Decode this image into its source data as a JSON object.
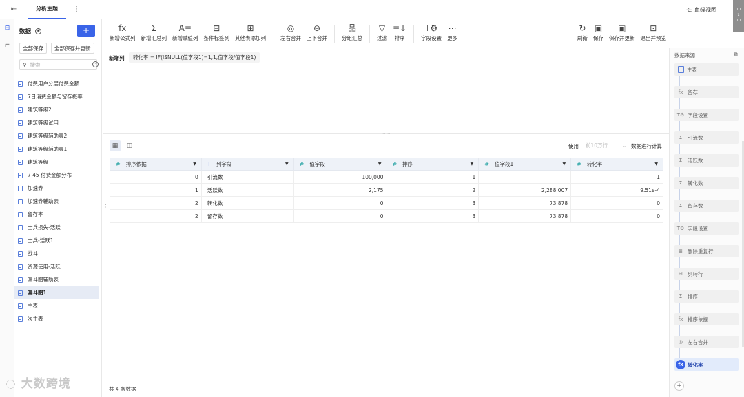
{
  "topbar": {
    "tab_label": "分析主题",
    "right_label": "血缘视图",
    "badge_lines": [
      "0.1",
      "1",
      "0.1"
    ]
  },
  "sidebar": {
    "title": "数据",
    "save_all": "全部保存",
    "save_all_update": "全部保存并更新",
    "search_placeholder": "搜索",
    "items": [
      {
        "label": "付费用户分层付费金额"
      },
      {
        "label": "7日消费金额与留存概率"
      },
      {
        "label": "建筑等级2"
      },
      {
        "label": "建筑等级试用"
      },
      {
        "label": "建筑等级辅助表2"
      },
      {
        "label": "建筑等级辅助表1"
      },
      {
        "label": "建筑等级"
      },
      {
        "label": "7 45 付费金额分布"
      },
      {
        "label": "加速券"
      },
      {
        "label": "加速券辅助表"
      },
      {
        "label": "留存率"
      },
      {
        "label": "士兵损失-活跃"
      },
      {
        "label": "士兵-活跃1"
      },
      {
        "label": "战斗"
      },
      {
        "label": "资源使用-活跃"
      },
      {
        "label": "漏斗图辅助表"
      },
      {
        "label": "漏斗图1",
        "selected": true
      },
      {
        "label": "主表"
      },
      {
        "label": "次主表"
      }
    ]
  },
  "toolbar": {
    "left": [
      {
        "icon": "fx",
        "label": "新增公式列",
        "name": "add-formula-column-button"
      },
      {
        "icon": "Σ",
        "label": "新增汇总列",
        "name": "add-summary-column-button"
      },
      {
        "icon": "A≡",
        "label": "新增赋值列",
        "name": "add-assign-column-button"
      },
      {
        "icon": "⊟",
        "label": "条件标签列",
        "name": "condition-label-column-button"
      },
      {
        "icon": "⊞",
        "label": "其他表添加列",
        "name": "add-column-from-table-button"
      },
      {
        "icon": "◎",
        "label": "左右合并",
        "name": "left-right-merge-button"
      },
      {
        "icon": "⊖",
        "label": "上下合并",
        "name": "up-down-merge-button"
      },
      {
        "icon": "品",
        "label": "分组汇总",
        "name": "group-summary-button"
      },
      {
        "icon": "▽",
        "label": "过滤",
        "name": "filter-button"
      },
      {
        "icon": "≡↓",
        "label": "排序",
        "name": "sort-button"
      },
      {
        "icon": "T⚙",
        "label": "字段设置",
        "name": "field-settings-button"
      },
      {
        "icon": "⋯",
        "label": "更多",
        "name": "more-button"
      }
    ],
    "right": [
      {
        "icon": "↻",
        "label": "刷新",
        "name": "refresh-button"
      },
      {
        "icon": "▣",
        "label": "保存",
        "name": "save-button"
      },
      {
        "icon": "▣",
        "label": "保存并更新",
        "name": "save-update-button"
      },
      {
        "icon": "⊡",
        "label": "退出并预览",
        "name": "exit-preview-button"
      }
    ]
  },
  "formula": {
    "label": "新增列",
    "expression": "转化率 = IF(ISNULL(值字段1)=1,1,值字段/值字段1)"
  },
  "gridbar": {
    "use_label": "使用",
    "rows_placeholder": "前10万行",
    "calc_label": "数据进行计算"
  },
  "table": {
    "columns": [
      {
        "type": "#",
        "label": "排序依据"
      },
      {
        "type": "T",
        "label": "列字段"
      },
      {
        "type": "#",
        "label": "值字段"
      },
      {
        "type": "#",
        "label": "排序"
      },
      {
        "type": "#",
        "label": "值字段1"
      },
      {
        "type": "#",
        "label": "转化率"
      }
    ],
    "rows": [
      [
        "0",
        "引流数",
        "100,000",
        "1",
        "",
        "1"
      ],
      [
        "1",
        "活跃数",
        "2,175",
        "2",
        "2,288,007",
        "9.51e-4"
      ],
      [
        "2",
        "转化数",
        "0",
        "3",
        "73,878",
        "0"
      ],
      [
        "2",
        "留存数",
        "0",
        "3",
        "73,878",
        "0"
      ]
    ]
  },
  "footer": {
    "count_text": "共 4 条数据"
  },
  "watermark": {
    "text": "大数跨境"
  },
  "right_panel": {
    "title": "数据来源",
    "nodes": [
      {
        "icon": "doc",
        "label": "主表"
      },
      {
        "icon": "fx",
        "label": "留存"
      },
      {
        "icon": "T⚙",
        "label": "字段设置"
      },
      {
        "icon": "Σ",
        "label": "引流数"
      },
      {
        "icon": "Σ",
        "label": "活跃数"
      },
      {
        "icon": "Σ",
        "label": "转化数"
      },
      {
        "icon": "Σ",
        "label": "留存数"
      },
      {
        "icon": "T⚙",
        "label": "字段设置"
      },
      {
        "icon": "≣",
        "label": "删除重复行"
      },
      {
        "icon": "⊟",
        "label": "列转行"
      },
      {
        "icon": "Σ",
        "label": "排序"
      },
      {
        "icon": "fx",
        "label": "排序依据"
      },
      {
        "icon": "◎",
        "label": "左右合并"
      },
      {
        "icon": "fx",
        "label": "转化率",
        "active": true
      }
    ]
  }
}
